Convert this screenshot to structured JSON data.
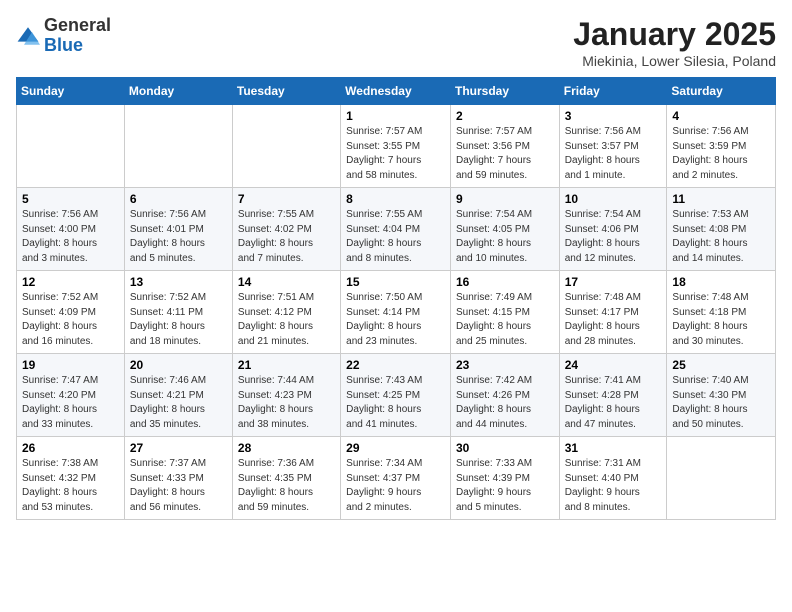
{
  "header": {
    "logo": {
      "general": "General",
      "blue": "Blue"
    },
    "title": "January 2025",
    "subtitle": "Miekinia, Lower Silesia, Poland"
  },
  "weekdays": [
    "Sunday",
    "Monday",
    "Tuesday",
    "Wednesday",
    "Thursday",
    "Friday",
    "Saturday"
  ],
  "weeks": [
    [
      {
        "day": "",
        "info": ""
      },
      {
        "day": "",
        "info": ""
      },
      {
        "day": "",
        "info": ""
      },
      {
        "day": "1",
        "info": "Sunrise: 7:57 AM\nSunset: 3:55 PM\nDaylight: 7 hours\nand 58 minutes."
      },
      {
        "day": "2",
        "info": "Sunrise: 7:57 AM\nSunset: 3:56 PM\nDaylight: 7 hours\nand 59 minutes."
      },
      {
        "day": "3",
        "info": "Sunrise: 7:56 AM\nSunset: 3:57 PM\nDaylight: 8 hours\nand 1 minute."
      },
      {
        "day": "4",
        "info": "Sunrise: 7:56 AM\nSunset: 3:59 PM\nDaylight: 8 hours\nand 2 minutes."
      }
    ],
    [
      {
        "day": "5",
        "info": "Sunrise: 7:56 AM\nSunset: 4:00 PM\nDaylight: 8 hours\nand 3 minutes."
      },
      {
        "day": "6",
        "info": "Sunrise: 7:56 AM\nSunset: 4:01 PM\nDaylight: 8 hours\nand 5 minutes."
      },
      {
        "day": "7",
        "info": "Sunrise: 7:55 AM\nSunset: 4:02 PM\nDaylight: 8 hours\nand 7 minutes."
      },
      {
        "day": "8",
        "info": "Sunrise: 7:55 AM\nSunset: 4:04 PM\nDaylight: 8 hours\nand 8 minutes."
      },
      {
        "day": "9",
        "info": "Sunrise: 7:54 AM\nSunset: 4:05 PM\nDaylight: 8 hours\nand 10 minutes."
      },
      {
        "day": "10",
        "info": "Sunrise: 7:54 AM\nSunset: 4:06 PM\nDaylight: 8 hours\nand 12 minutes."
      },
      {
        "day": "11",
        "info": "Sunrise: 7:53 AM\nSunset: 4:08 PM\nDaylight: 8 hours\nand 14 minutes."
      }
    ],
    [
      {
        "day": "12",
        "info": "Sunrise: 7:52 AM\nSunset: 4:09 PM\nDaylight: 8 hours\nand 16 minutes."
      },
      {
        "day": "13",
        "info": "Sunrise: 7:52 AM\nSunset: 4:11 PM\nDaylight: 8 hours\nand 18 minutes."
      },
      {
        "day": "14",
        "info": "Sunrise: 7:51 AM\nSunset: 4:12 PM\nDaylight: 8 hours\nand 21 minutes."
      },
      {
        "day": "15",
        "info": "Sunrise: 7:50 AM\nSunset: 4:14 PM\nDaylight: 8 hours\nand 23 minutes."
      },
      {
        "day": "16",
        "info": "Sunrise: 7:49 AM\nSunset: 4:15 PM\nDaylight: 8 hours\nand 25 minutes."
      },
      {
        "day": "17",
        "info": "Sunrise: 7:48 AM\nSunset: 4:17 PM\nDaylight: 8 hours\nand 28 minutes."
      },
      {
        "day": "18",
        "info": "Sunrise: 7:48 AM\nSunset: 4:18 PM\nDaylight: 8 hours\nand 30 minutes."
      }
    ],
    [
      {
        "day": "19",
        "info": "Sunrise: 7:47 AM\nSunset: 4:20 PM\nDaylight: 8 hours\nand 33 minutes."
      },
      {
        "day": "20",
        "info": "Sunrise: 7:46 AM\nSunset: 4:21 PM\nDaylight: 8 hours\nand 35 minutes."
      },
      {
        "day": "21",
        "info": "Sunrise: 7:44 AM\nSunset: 4:23 PM\nDaylight: 8 hours\nand 38 minutes."
      },
      {
        "day": "22",
        "info": "Sunrise: 7:43 AM\nSunset: 4:25 PM\nDaylight: 8 hours\nand 41 minutes."
      },
      {
        "day": "23",
        "info": "Sunrise: 7:42 AM\nSunset: 4:26 PM\nDaylight: 8 hours\nand 44 minutes."
      },
      {
        "day": "24",
        "info": "Sunrise: 7:41 AM\nSunset: 4:28 PM\nDaylight: 8 hours\nand 47 minutes."
      },
      {
        "day": "25",
        "info": "Sunrise: 7:40 AM\nSunset: 4:30 PM\nDaylight: 8 hours\nand 50 minutes."
      }
    ],
    [
      {
        "day": "26",
        "info": "Sunrise: 7:38 AM\nSunset: 4:32 PM\nDaylight: 8 hours\nand 53 minutes."
      },
      {
        "day": "27",
        "info": "Sunrise: 7:37 AM\nSunset: 4:33 PM\nDaylight: 8 hours\nand 56 minutes."
      },
      {
        "day": "28",
        "info": "Sunrise: 7:36 AM\nSunset: 4:35 PM\nDaylight: 8 hours\nand 59 minutes."
      },
      {
        "day": "29",
        "info": "Sunrise: 7:34 AM\nSunset: 4:37 PM\nDaylight: 9 hours\nand 2 minutes."
      },
      {
        "day": "30",
        "info": "Sunrise: 7:33 AM\nSunset: 4:39 PM\nDaylight: 9 hours\nand 5 minutes."
      },
      {
        "day": "31",
        "info": "Sunrise: 7:31 AM\nSunset: 4:40 PM\nDaylight: 9 hours\nand 8 minutes."
      },
      {
        "day": "",
        "info": ""
      }
    ]
  ]
}
